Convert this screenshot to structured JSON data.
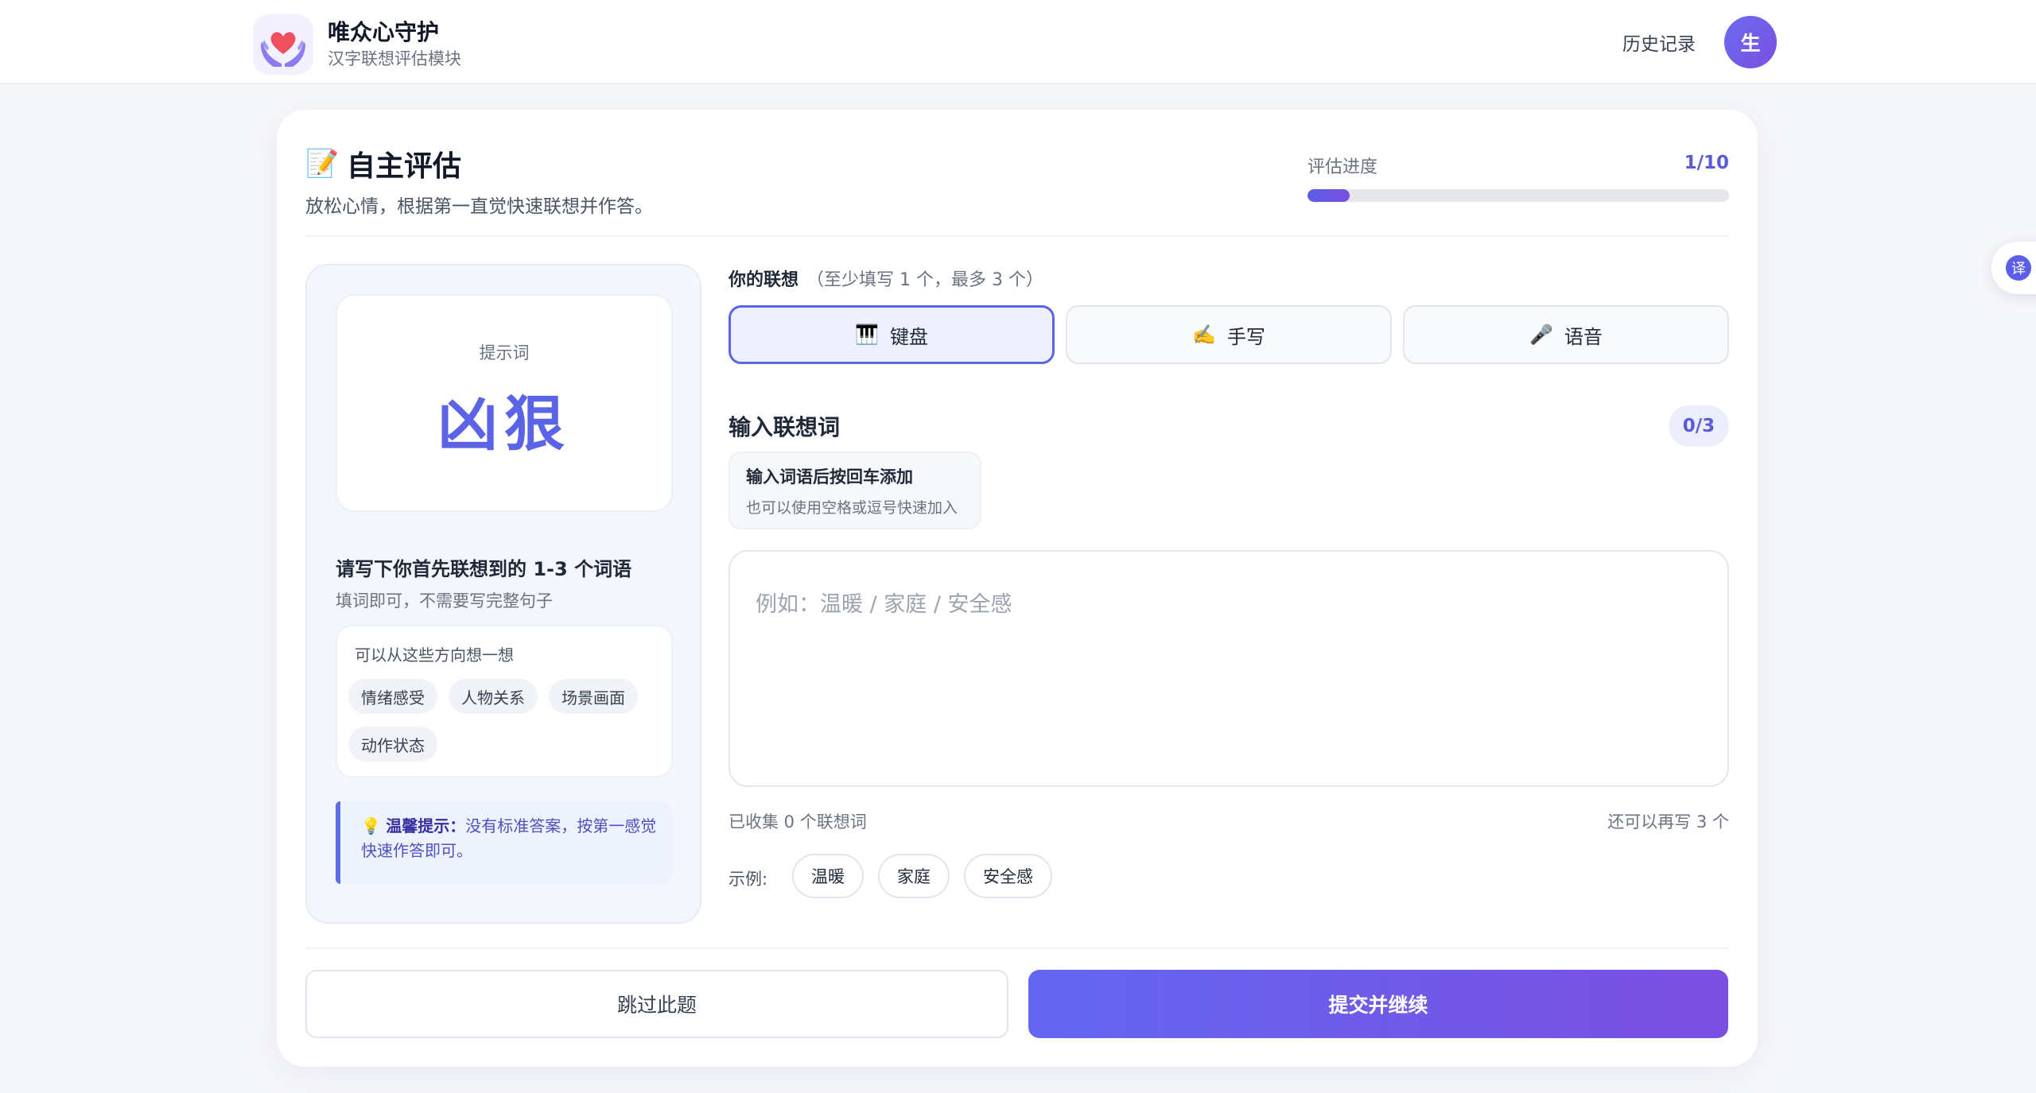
{
  "header": {
    "brand_title": "唯众心守护",
    "brand_subtitle": "汉字联想评估模块",
    "history_link": "历史记录",
    "avatar_initial": "生",
    "logo_icon": "heart-in-hands-icon"
  },
  "float": {
    "translate_label": "译"
  },
  "page": {
    "title": "自主评估",
    "title_icon": "memo-icon",
    "subtitle": "放松心情，根据第一直觉快速联想并作答。"
  },
  "progress": {
    "label": "评估进度",
    "value_text": "1/10",
    "current": 1,
    "total": 10,
    "fraction": 0.1
  },
  "prompt": {
    "label": "提示词",
    "word": "凶狠",
    "instruction_title": "请写下你首先联想到的 1-3 个词语",
    "instruction_sub": "填词即可，不需要写完整句子",
    "directions_title": "可以从这些方向想一想",
    "directions": [
      "情绪感受",
      "人物关系",
      "场景画面",
      "动作状态"
    ],
    "tip_icon": "lightbulb-icon",
    "tip_label": "温馨提示：",
    "tip_text": "没有标准答案，按第一感觉快速作答即可。"
  },
  "association": {
    "label": "你的联想",
    "hint": "（至少填写 1 个，最多 3 个）",
    "modes": [
      {
        "label": "键盘",
        "icon": "piano-keys-icon",
        "active": true
      },
      {
        "label": "手写",
        "icon": "writing-hand-icon",
        "active": false
      },
      {
        "label": "语音",
        "icon": "microphone-icon",
        "active": false
      }
    ],
    "input_title": "输入联想词",
    "count": "0/3",
    "hint_main": "输入词语后按回车添加",
    "hint_sub": "也可以使用空格或逗号快速加入",
    "placeholder": "例如：温暖 / 家庭 / 安全感",
    "collected": "已收集 0 个联想词",
    "remaining": "还可以再写 3 个",
    "examples_label": "示例:",
    "examples": [
      "温暖",
      "家庭",
      "安全感"
    ]
  },
  "actions": {
    "skip": "跳过此题",
    "submit": "提交并继续"
  },
  "colors": {
    "accent": "#5b63e6",
    "accent_gradient_end": "#7b4fe0",
    "page_bg": "#f6f7fb"
  }
}
